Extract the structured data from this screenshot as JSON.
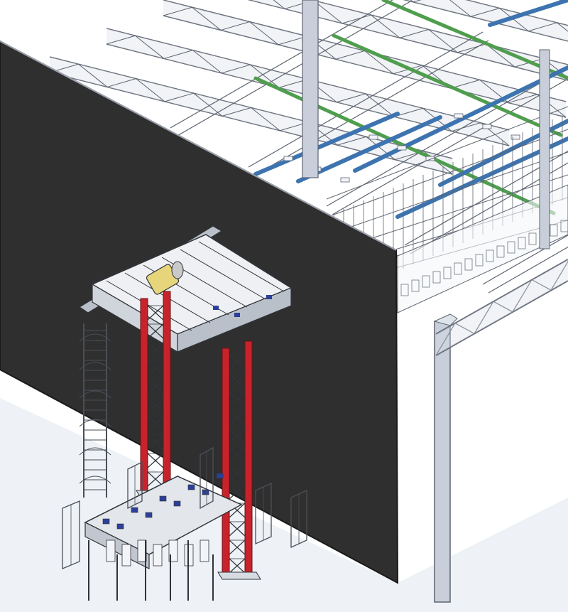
{
  "scene": {
    "kind": "3d-cad-isometric-render",
    "colors": {
      "background": "#ffffff",
      "floor_shade": "#e9eef3",
      "wall": "#2f2f2f",
      "wall_edge": "#1a1a1a",
      "truss": "#d6dce6",
      "truss_stroke": "#5d6470",
      "column": "#c8cfda",
      "green_pipe": "#4f9e4d",
      "blue_pipe": "#3d74b0",
      "red_tower": "#c8232b",
      "machine_frame": "#b9c0ca",
      "machine_dark": "#30343a",
      "accent_yellow": "#e6d57a",
      "accent_blue": "#2c3f9a",
      "fence_stroke": "#4a4f57"
    },
    "components": [
      "roof-truss-grid",
      "green-pipes",
      "blue-ducts",
      "steel-columns",
      "divider-wall",
      "lift-gantry",
      "red-lift-towers",
      "access-ladder",
      "machine-base",
      "safety-fences",
      "catwalk-platform"
    ]
  }
}
